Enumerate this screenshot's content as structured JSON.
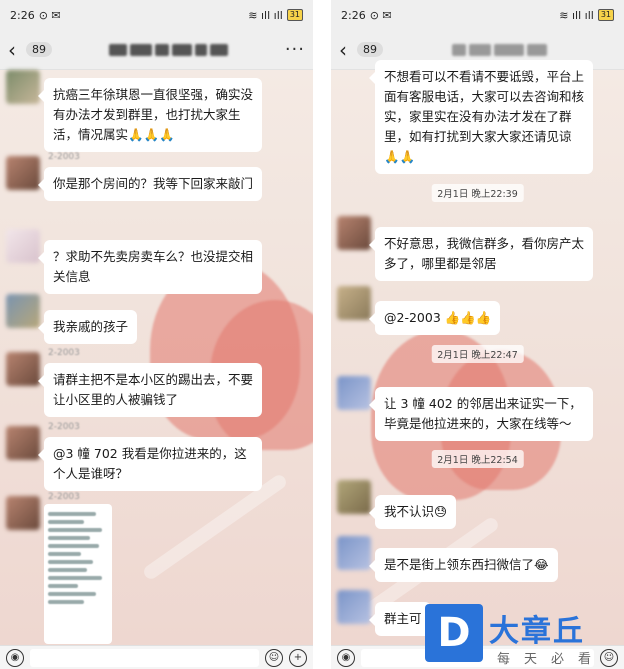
{
  "left": {
    "status": {
      "time": "2:26",
      "battery": "31"
    },
    "nav": {
      "unread": "89"
    },
    "messages": [
      {
        "text": "抗癌三年徐琪恩一直很坚强，确实没有办法才发到群里，也打扰大家生活，情况属实🙏🙏🙏"
      },
      {
        "sender": "2-2003",
        "text": "你是那个房间的？我等下回家来敲门"
      },
      {
        "text": "？求助不先卖房卖车么？也没提交相关信息"
      },
      {
        "text": "我亲戚的孩子"
      },
      {
        "sender": "2-2003",
        "text": "请群主把不是本小区的踢出去，不要让小区里的人被骗钱了"
      },
      {
        "sender": "2-2003",
        "text": "@3 幢 702  我看是你拉进来的，这个人是谁呀？"
      },
      {
        "sender": "2-2003"
      }
    ]
  },
  "right": {
    "status": {
      "time": "2:26",
      "battery": "31"
    },
    "nav": {
      "unread": "89"
    },
    "messages": [
      {
        "text": "不想看可以不看请不要诋毁，平台上面有客服电话，大家可以去咨询和核实，家里实在没有办法才发在了群里，如有打扰到大家大家还请见谅🙏🙏"
      },
      {
        "time": "2月1日 晚上22:39"
      },
      {
        "text": "不好意思，我微信群多，看你房产太多了，哪里都是邻居"
      },
      {
        "text": "@2-2003 👍👍👍"
      },
      {
        "time": "2月1日 晚上22:47"
      },
      {
        "text": "让 3 幢 402 的邻居出来证实一下，毕竟是他拉进来的，大家在线等～"
      },
      {
        "time": "2月1日 晚上22:54"
      },
      {
        "text": "我不认识😓"
      },
      {
        "text": "是不是街上领东西扫微信了😂"
      },
      {
        "text": "群主可"
      }
    ]
  },
  "watermark": {
    "logo_letter": "D",
    "brand": "大章丘",
    "slogan": "每天必看"
  },
  "icons": [
    "back-chevron-icon",
    "more-dots-icon",
    "voice-icon",
    "emoji-icon",
    "add-icon"
  ],
  "colors": {
    "bubble": "#ffffff",
    "accent": "#2a73d9",
    "heart": "#e2786e"
  }
}
